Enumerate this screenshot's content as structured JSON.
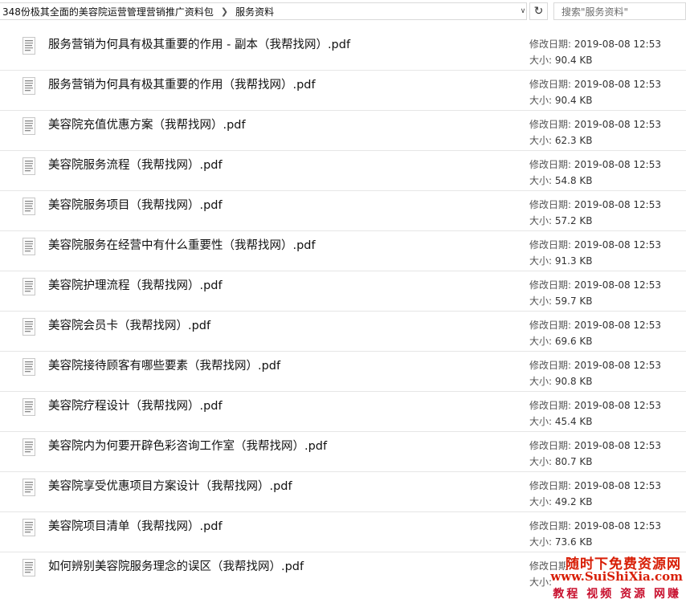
{
  "address_bar": {
    "segments": [
      "348份极其全面的美容院运营管理营销推广资料包",
      "服务资料"
    ]
  },
  "search": {
    "placeholder": "搜索\"服务资料\""
  },
  "labels": {
    "modified": "修改日期: ",
    "size": "大小: "
  },
  "files": [
    {
      "name": "服务营销为何具有极其重要的作用 - 副本（我帮找网）.pdf",
      "modified": "2019-08-08 12:53",
      "size": "90.4 KB"
    },
    {
      "name": "服务营销为何具有极其重要的作用（我帮找网）.pdf",
      "modified": "2019-08-08 12:53",
      "size": "90.4 KB"
    },
    {
      "name": "美容院充值优惠方案（我帮找网）.pdf",
      "modified": "2019-08-08 12:53",
      "size": "62.3 KB"
    },
    {
      "name": "美容院服务流程（我帮找网）.pdf",
      "modified": "2019-08-08 12:53",
      "size": "54.8 KB"
    },
    {
      "name": "美容院服务项目（我帮找网）.pdf",
      "modified": "2019-08-08 12:53",
      "size": "57.2 KB"
    },
    {
      "name": "美容院服务在经营中有什么重要性（我帮找网）.pdf",
      "modified": "2019-08-08 12:53",
      "size": "91.3 KB"
    },
    {
      "name": "美容院护理流程（我帮找网）.pdf",
      "modified": "2019-08-08 12:53",
      "size": "59.7 KB"
    },
    {
      "name": "美容院会员卡（我帮找网）.pdf",
      "modified": "2019-08-08 12:53",
      "size": "69.6 KB"
    },
    {
      "name": "美容院接待顾客有哪些要素（我帮找网）.pdf",
      "modified": "2019-08-08 12:53",
      "size": "90.8 KB"
    },
    {
      "name": "美容院疗程设计（我帮找网）.pdf",
      "modified": "2019-08-08 12:53",
      "size": "45.4 KB"
    },
    {
      "name": "美容院内为何要开辟色彩咨询工作室（我帮找网）.pdf",
      "modified": "2019-08-08 12:53",
      "size": "80.7 KB"
    },
    {
      "name": "美容院享受优惠项目方案设计（我帮找网）.pdf",
      "modified": "2019-08-08 12:53",
      "size": "49.2 KB"
    },
    {
      "name": "美容院项目清单（我帮找网）.pdf",
      "modified": "2019-08-08 12:53",
      "size": "73.6 KB"
    },
    {
      "name": "如何辨别美容院服务理念的误区（我帮找网）.pdf",
      "modified": "",
      "size": ""
    }
  ],
  "watermark": {
    "line1": "随时下免费资源网",
    "line2": "www.SuiShiXia.com",
    "line3": "教程 视频 资源 网赚"
  }
}
